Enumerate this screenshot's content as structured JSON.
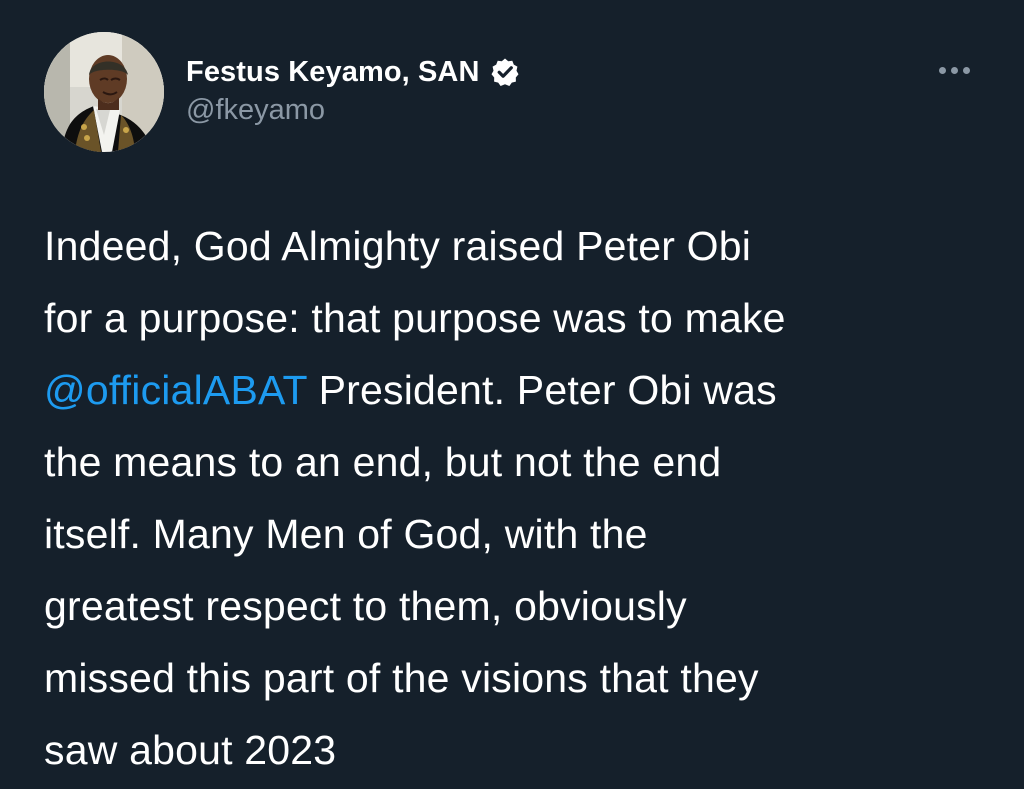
{
  "author": {
    "name": "Festus Keyamo, SAN",
    "handle": "@fkeyamo",
    "verified": true
  },
  "tweet": {
    "lines": [
      {
        "before": "Indeed, God Almighty raised Peter Obi"
      },
      {
        "before": "for a purpose: that purpose was to make"
      },
      {
        "mention": "@officialABAT",
        "after": " President. Peter Obi was"
      },
      {
        "before": "the means to an end, but not the end"
      },
      {
        "before": "itself. Many Men of God, with the"
      },
      {
        "before": "greatest respect to them, obviously"
      },
      {
        "before": "missed this part of the visions that they"
      },
      {
        "before": "saw about 2023"
      }
    ]
  },
  "icons": {
    "more": "more-horizontal-icon",
    "verified": "verified-badge-icon"
  },
  "colors": {
    "background": "#15202b",
    "text": "#ffffff",
    "secondary_text": "#8b98a5",
    "link": "#1d9bf0"
  }
}
